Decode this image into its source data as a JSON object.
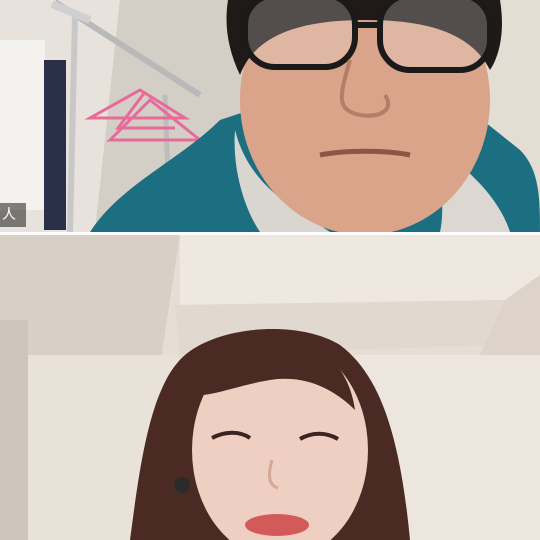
{
  "participants": [
    {
      "name_tag": "人",
      "role": "remote"
    },
    {
      "name_tag": "",
      "role": "remote"
    }
  ],
  "colors": {
    "divider": "#ffffff",
    "name_tag_bg": "#1e1e1e",
    "hoodie_teal": "#1c6f80",
    "hanger_pink": "#e86a9a"
  }
}
